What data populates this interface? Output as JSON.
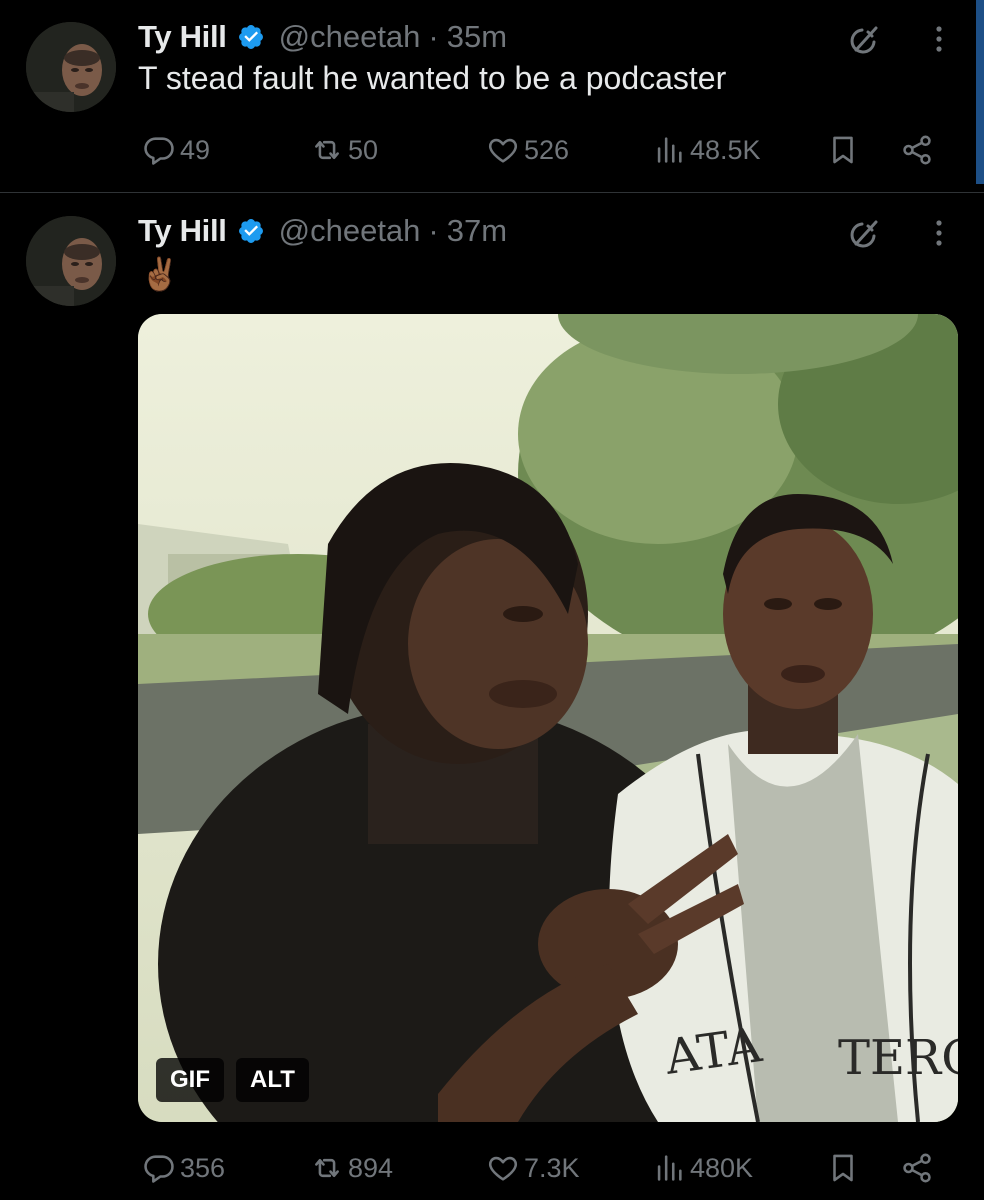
{
  "tweets": [
    {
      "name": "Ty Hill",
      "handle": "@cheetah",
      "separator": "·",
      "time": "35m",
      "text": "T stead fault he wanted to be a podcaster",
      "stats": {
        "replies": "49",
        "reposts": "50",
        "likes": "526",
        "views": "48.5K"
      }
    },
    {
      "name": "Ty Hill",
      "handle": "@cheetah",
      "separator": "·",
      "time": "37m",
      "text": "✌🏾",
      "media": {
        "badge_gif": "GIF",
        "badge_alt": "ALT"
      },
      "stats": {
        "replies": "356",
        "reposts": "894",
        "likes": "7.3K",
        "views": "480K"
      }
    }
  ],
  "icons": {
    "verified": "verified-badge-icon",
    "grok": "grok-icon",
    "more": "more-dots-icon",
    "reply": "reply-icon",
    "repost": "repost-icon",
    "like": "heart-icon",
    "views": "views-icon",
    "bookmark": "bookmark-icon",
    "share": "share-icon"
  },
  "colors": {
    "background": "#000000",
    "text_primary": "#e7e9ea",
    "text_secondary": "#71767b",
    "verified": "#1d9bf0",
    "divider": "#2f3336"
  }
}
